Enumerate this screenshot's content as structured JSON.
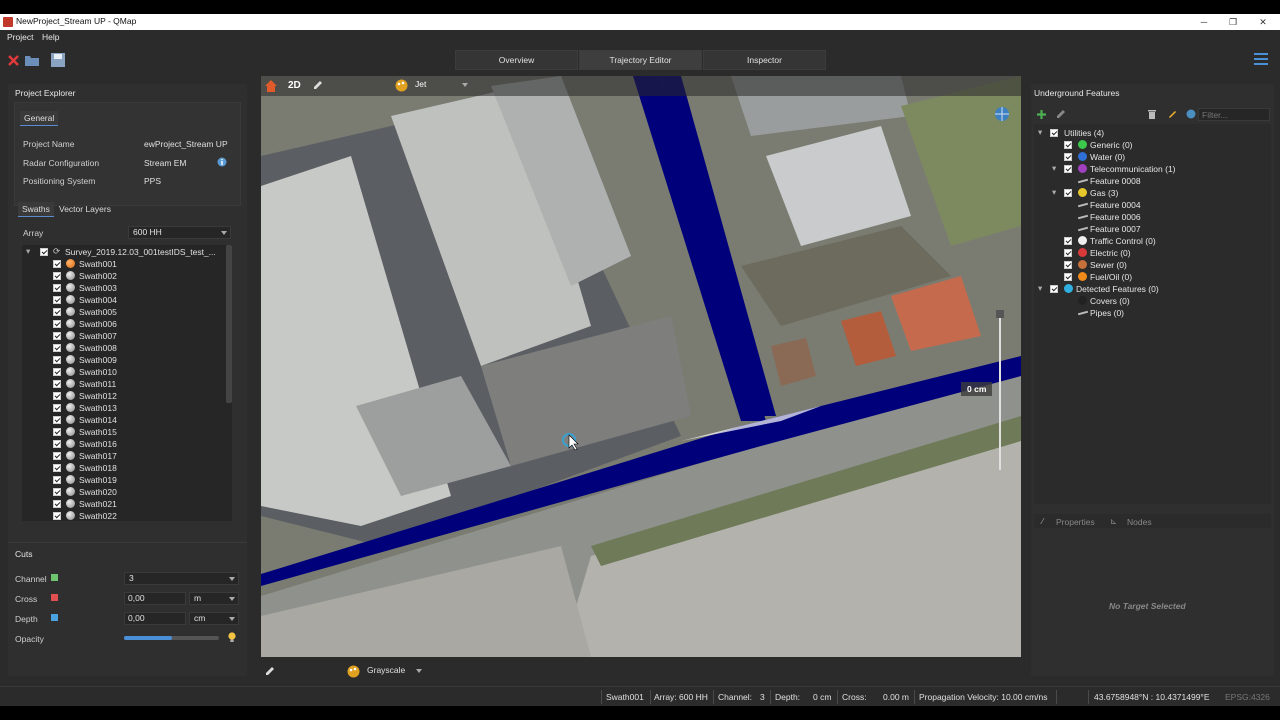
{
  "window": {
    "title": "NewProject_Stream UP - QMap",
    "minimize": "─",
    "maximize": "❐",
    "close": "✕"
  },
  "menu": [
    "Project",
    "Help"
  ],
  "view_tabs": [
    "Overview",
    "Trajectory Editor",
    "Inspector"
  ],
  "project_explorer": {
    "title": "Project Explorer",
    "general_tab": "General",
    "fields": [
      {
        "label": "Project Name",
        "value": "ewProject_Stream UP"
      },
      {
        "label": "Radar Configuration",
        "value": "Stream EM"
      },
      {
        "label": "Positioning System",
        "value": "PPS"
      }
    ],
    "tabs": [
      "Swaths",
      "Vector Layers"
    ],
    "array_label": "Array",
    "array_value": "600 HH",
    "survey": "Survey_2019.12.03_001testIDS_test_...",
    "swaths": [
      "Swath001",
      "Swath002",
      "Swath003",
      "Swath004",
      "Swath005",
      "Swath006",
      "Swath007",
      "Swath008",
      "Swath009",
      "Swath010",
      "Swath011",
      "Swath012",
      "Swath013",
      "Swath014",
      "Swath015",
      "Swath016",
      "Swath017",
      "Swath018",
      "Swath019",
      "Swath020",
      "Swath021",
      "Swath022"
    ]
  },
  "cuts": {
    "title": "Cuts",
    "channel_label": "Channel",
    "channel_value": "3",
    "cross_label": "Cross",
    "cross_value": "0,00",
    "cross_unit": "m",
    "depth_label": "Depth",
    "depth_value": "0,00",
    "depth_unit": "cm",
    "opacity_label": "Opacity",
    "opacity_level": 0.5,
    "channel_color": "#6fc46f",
    "cross_color": "#e05050",
    "depth_color": "#4aa3e0"
  },
  "map": {
    "mode_label": "2D",
    "colormap": "Jet",
    "depth_readout": "0 cm",
    "bottom_colormap": "Grayscale",
    "path_color": "#00007a"
  },
  "underground": {
    "title": "Underground Features",
    "filter_placeholder": "Filter...",
    "items": [
      {
        "label": "Utilities (4)",
        "level": 0,
        "icon": ""
      },
      {
        "label": "Generic (0)",
        "level": 1,
        "icon": "green"
      },
      {
        "label": "Water (0)",
        "level": 1,
        "icon": "blue"
      },
      {
        "label": "Telecommunication (1)",
        "level": 1,
        "icon": "purple"
      },
      {
        "label": "Feature 0008",
        "level": 2,
        "icon": "line"
      },
      {
        "label": "Gas (3)",
        "level": 1,
        "icon": "yellow"
      },
      {
        "label": "Feature 0004",
        "level": 2,
        "icon": "line"
      },
      {
        "label": "Feature 0006",
        "level": 2,
        "icon": "line"
      },
      {
        "label": "Feature 0007",
        "level": 2,
        "icon": "line"
      },
      {
        "label": "Traffic Control (0)",
        "level": 1,
        "icon": "white"
      },
      {
        "label": "Electric (0)",
        "level": 1,
        "icon": "red"
      },
      {
        "label": "Sewer (0)",
        "level": 1,
        "icon": "brown"
      },
      {
        "label": "Fuel/Oil (0)",
        "level": 1,
        "icon": "orange"
      },
      {
        "label": "Detected Features (0)",
        "level": 0,
        "icon": "cyan"
      },
      {
        "label": "Covers (0)",
        "level": 1,
        "icon": "dark"
      },
      {
        "label": "Pipes (0)",
        "level": 1,
        "icon": "line"
      }
    ],
    "properties_tab": "Properties",
    "nodes_tab": "Nodes",
    "no_target": "No Target Selected"
  },
  "status": {
    "swath": "Swath001",
    "array": "Array: 600 HH",
    "channel_label": "Channel:",
    "channel_value": "3",
    "depth_label": "Depth:",
    "depth_value": "0 cm",
    "cross_label": "Cross:",
    "cross_value": "0.00 m",
    "velocity": "Propagation Velocity: 10.00 cm/ns",
    "coords": "43.6758948°N : 10.4371499°E",
    "epsg": "EPSG:4326"
  }
}
